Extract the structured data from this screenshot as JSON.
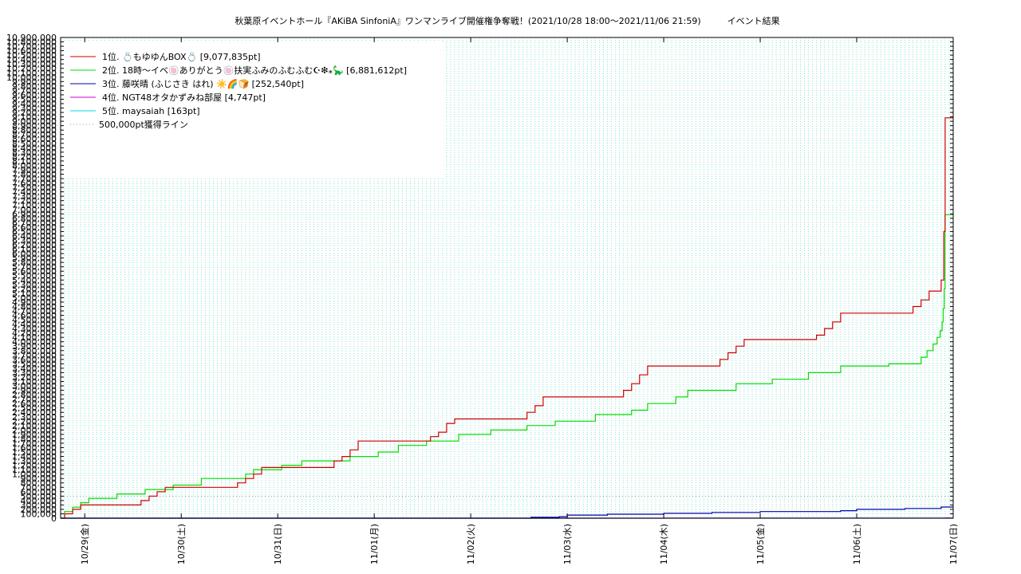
{
  "chart_data": {
    "type": "line",
    "title": "秋葉原イベントホール『AKiBA SinfoniA』ワンマンライブ開催権争奪戦！(2021/10/28 18:00～2021/11/06 21:59)　　　イベント結果",
    "xlabel": "",
    "ylabel": "",
    "x_range": [
      "2021-10-28 18:00",
      "2021-11-07 00:00"
    ],
    "ylim": [
      0,
      10900000
    ],
    "y_tick_step": 100000,
    "x_ticks": [
      "10/29(金)",
      "10/30(土)",
      "10/31(日)",
      "11/01(月)",
      "11/02(火)",
      "11/03(水)",
      "11/04(木)",
      "11/05(金)",
      "11/06(土)",
      "11/07(日)"
    ],
    "grid": true,
    "legend_position": "top-left",
    "threshold": {
      "name": "500,000pt獲得ライン",
      "value": 500000,
      "color": "#999999"
    },
    "series": [
      {
        "name": "1位. 💍もゆゆんBOX💍 [9,077,835pt]",
        "color": "#cc0000",
        "final": 9077835,
        "points": [
          [
            "2021-10-28 18:00",
            0
          ],
          [
            "2021-10-28 19:00",
            100000
          ],
          [
            "2021-10-28 21:00",
            200000
          ],
          [
            "2021-10-28 23:00",
            300000
          ],
          [
            "2021-10-29 12:00",
            300000
          ],
          [
            "2021-10-29 14:00",
            400000
          ],
          [
            "2021-10-29 16:00",
            500000
          ],
          [
            "2021-10-29 18:00",
            600000
          ],
          [
            "2021-10-29 20:00",
            700000
          ],
          [
            "2021-10-30 12:00",
            700000
          ],
          [
            "2021-10-30 14:00",
            800000
          ],
          [
            "2021-10-30 16:00",
            900000
          ],
          [
            "2021-10-30 18:00",
            1000000
          ],
          [
            "2021-10-30 20:00",
            1150000
          ],
          [
            "2021-10-31 12:00",
            1150000
          ],
          [
            "2021-10-31 14:00",
            1300000
          ],
          [
            "2021-10-31 16:00",
            1400000
          ],
          [
            "2021-10-31 18:00",
            1550000
          ],
          [
            "2021-10-31 20:00",
            1750000
          ],
          [
            "2021-11-01 12:00",
            1750000
          ],
          [
            "2021-11-01 14:00",
            1850000
          ],
          [
            "2021-11-01 16:00",
            1950000
          ],
          [
            "2021-11-01 18:00",
            2150000
          ],
          [
            "2021-11-01 20:00",
            2250000
          ],
          [
            "2021-11-02 12:00",
            2250000
          ],
          [
            "2021-11-02 14:00",
            2400000
          ],
          [
            "2021-11-02 16:00",
            2550000
          ],
          [
            "2021-11-02 18:00",
            2750000
          ],
          [
            "2021-11-03 12:00",
            2750000
          ],
          [
            "2021-11-03 14:00",
            2900000
          ],
          [
            "2021-11-03 16:00",
            3050000
          ],
          [
            "2021-11-03 18:00",
            3250000
          ],
          [
            "2021-11-03 20:00",
            3450000
          ],
          [
            "2021-11-04 12:00",
            3450000
          ],
          [
            "2021-11-04 14:00",
            3600000
          ],
          [
            "2021-11-04 16:00",
            3750000
          ],
          [
            "2021-11-04 18:00",
            3900000
          ],
          [
            "2021-11-04 20:00",
            4050000
          ],
          [
            "2021-11-05 12:00",
            4050000
          ],
          [
            "2021-11-05 14:00",
            4150000
          ],
          [
            "2021-11-05 16:00",
            4300000
          ],
          [
            "2021-11-05 18:00",
            4450000
          ],
          [
            "2021-11-05 20:00",
            4650000
          ],
          [
            "2021-11-06 12:00",
            4650000
          ],
          [
            "2021-11-06 14:00",
            4800000
          ],
          [
            "2021-11-06 16:00",
            4950000
          ],
          [
            "2021-11-06 18:00",
            5150000
          ],
          [
            "2021-11-06 21:00",
            5400000
          ],
          [
            "2021-11-06 21:40",
            6500000
          ],
          [
            "2021-11-06 22:00",
            9077835
          ],
          [
            "2021-11-07 00:00",
            9077835
          ]
        ]
      },
      {
        "name": "2位. 18時〜イベ🍥ありがとう🍥扶実ふみのふむふむ☪︎❇︎⁎🦕 [6,881,612pt]",
        "color": "#00dd00",
        "final": 6881612,
        "points": [
          [
            "2021-10-28 18:00",
            0
          ],
          [
            "2021-10-28 19:00",
            150000
          ],
          [
            "2021-10-28 21:00",
            250000
          ],
          [
            "2021-10-28 23:00",
            350000
          ],
          [
            "2021-10-29 01:00",
            450000
          ],
          [
            "2021-10-29 08:00",
            550000
          ],
          [
            "2021-10-29 15:00",
            650000
          ],
          [
            "2021-10-29 22:00",
            750000
          ],
          [
            "2021-10-30 05:00",
            900000
          ],
          [
            "2021-10-30 16:00",
            1000000
          ],
          [
            "2021-10-30 18:00",
            1100000
          ],
          [
            "2021-10-31 01:00",
            1200000
          ],
          [
            "2021-10-31 06:00",
            1300000
          ],
          [
            "2021-10-31 18:00",
            1400000
          ],
          [
            "2021-11-01 01:00",
            1500000
          ],
          [
            "2021-11-01 06:00",
            1650000
          ],
          [
            "2021-11-01 13:00",
            1750000
          ],
          [
            "2021-11-01 21:00",
            1900000
          ],
          [
            "2021-11-02 05:00",
            2000000
          ],
          [
            "2021-11-02 14:00",
            2100000
          ],
          [
            "2021-11-02 21:00",
            2200000
          ],
          [
            "2021-11-03 07:00",
            2350000
          ],
          [
            "2021-11-03 16:00",
            2450000
          ],
          [
            "2021-11-03 20:00",
            2600000
          ],
          [
            "2021-11-04 03:00",
            2750000
          ],
          [
            "2021-11-04 06:00",
            2900000
          ],
          [
            "2021-11-04 18:00",
            3050000
          ],
          [
            "2021-11-05 03:00",
            3150000
          ],
          [
            "2021-11-05 12:00",
            3300000
          ],
          [
            "2021-11-05 20:00",
            3450000
          ],
          [
            "2021-11-06 08:00",
            3500000
          ],
          [
            "2021-11-06 16:00",
            3650000
          ],
          [
            "2021-11-06 17:30",
            3800000
          ],
          [
            "2021-11-06 19:00",
            3950000
          ],
          [
            "2021-11-06 20:00",
            4100000
          ],
          [
            "2021-11-06 20:45",
            4250000
          ],
          [
            "2021-11-06 21:15",
            4450000
          ],
          [
            "2021-11-06 21:30",
            4750000
          ],
          [
            "2021-11-06 21:45",
            5200000
          ],
          [
            "2021-11-06 21:59",
            6881612
          ],
          [
            "2021-11-07 00:00",
            6881612
          ]
        ]
      },
      {
        "name": "3位. 藤咲晴 (ふじさき はれ) ☀️🌈🍞 [252,540pt]",
        "color": "#0000aa",
        "final": 252540,
        "points": [
          [
            "2021-10-28 18:00",
            0
          ],
          [
            "2021-11-02 10:00",
            0
          ],
          [
            "2021-11-02 15:00",
            20000
          ],
          [
            "2021-11-02 22:00",
            35000
          ],
          [
            "2021-11-03 00:00",
            70000
          ],
          [
            "2021-11-03 10:00",
            90000
          ],
          [
            "2021-11-04 00:00",
            110000
          ],
          [
            "2021-11-04 12:00",
            130000
          ],
          [
            "2021-11-05 00:00",
            150000
          ],
          [
            "2021-11-05 20:00",
            170000
          ],
          [
            "2021-11-06 00:00",
            200000
          ],
          [
            "2021-11-06 12:00",
            220000
          ],
          [
            "2021-11-06 21:00",
            252540
          ],
          [
            "2021-11-07 00:00",
            252540
          ]
        ]
      },
      {
        "name": "4位. NGT48オタかずみね部屋 [4,747pt]",
        "color": "#cc00cc",
        "final": 4747,
        "points": [
          [
            "2021-10-28 18:00",
            0
          ],
          [
            "2021-11-04 00:00",
            2000
          ],
          [
            "2021-11-06 21:59",
            4747
          ],
          [
            "2021-11-07 00:00",
            4747
          ]
        ]
      },
      {
        "name": "5位. maysaiah [163pt]",
        "color": "#00dddd",
        "final": 163,
        "points": [
          [
            "2021-10-28 18:00",
            0
          ],
          [
            "2021-11-06 21:59",
            163
          ],
          [
            "2021-11-07 00:00",
            163
          ]
        ]
      }
    ]
  }
}
